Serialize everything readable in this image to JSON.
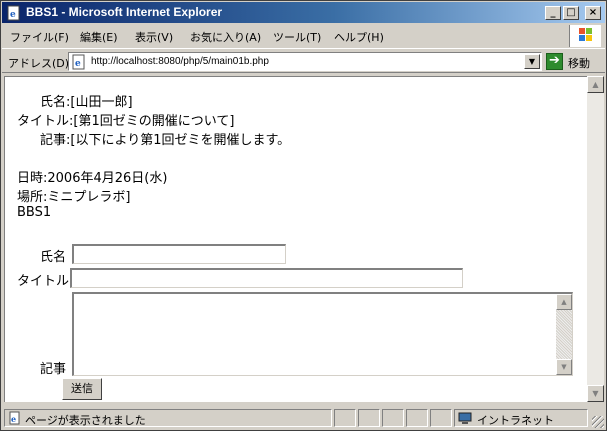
{
  "window": {
    "title": "BBS1 - Microsoft Internet Explorer",
    "minimize_icon": "minimize-icon",
    "maximize_icon": "maximize-icon",
    "close_icon": "close-icon",
    "title_color": "#0a246a"
  },
  "menu": {
    "items": [
      "ファイル(F)",
      "編集(E)",
      "表示(V)",
      "お気に入り(A)",
      "ツール(T)",
      "ヘルプ(H)"
    ]
  },
  "address": {
    "label": "アドレス(D)",
    "url": "http://localhost:8080/php/5/main01b.php",
    "go_label": "移動"
  },
  "page": {
    "post_name_line": "氏名:[山田一郎]",
    "post_title_line": "タイトル:[第1回ゼミの開催について]",
    "post_body_line": "記事:[以下により第1回ゼミを開催します。",
    "post_date_line": "日時:2006年4月26日(水)",
    "post_place_line": "場所:ミニプレラボ]",
    "heading": "BBS1",
    "form": {
      "name_label": "氏名",
      "name_value": "",
      "title_label": "タイトル",
      "title_value": "",
      "body_label": "記事",
      "body_value": "",
      "submit_label": "送信"
    }
  },
  "status": {
    "text": "ページが表示されました",
    "zone": "イントラネット"
  }
}
